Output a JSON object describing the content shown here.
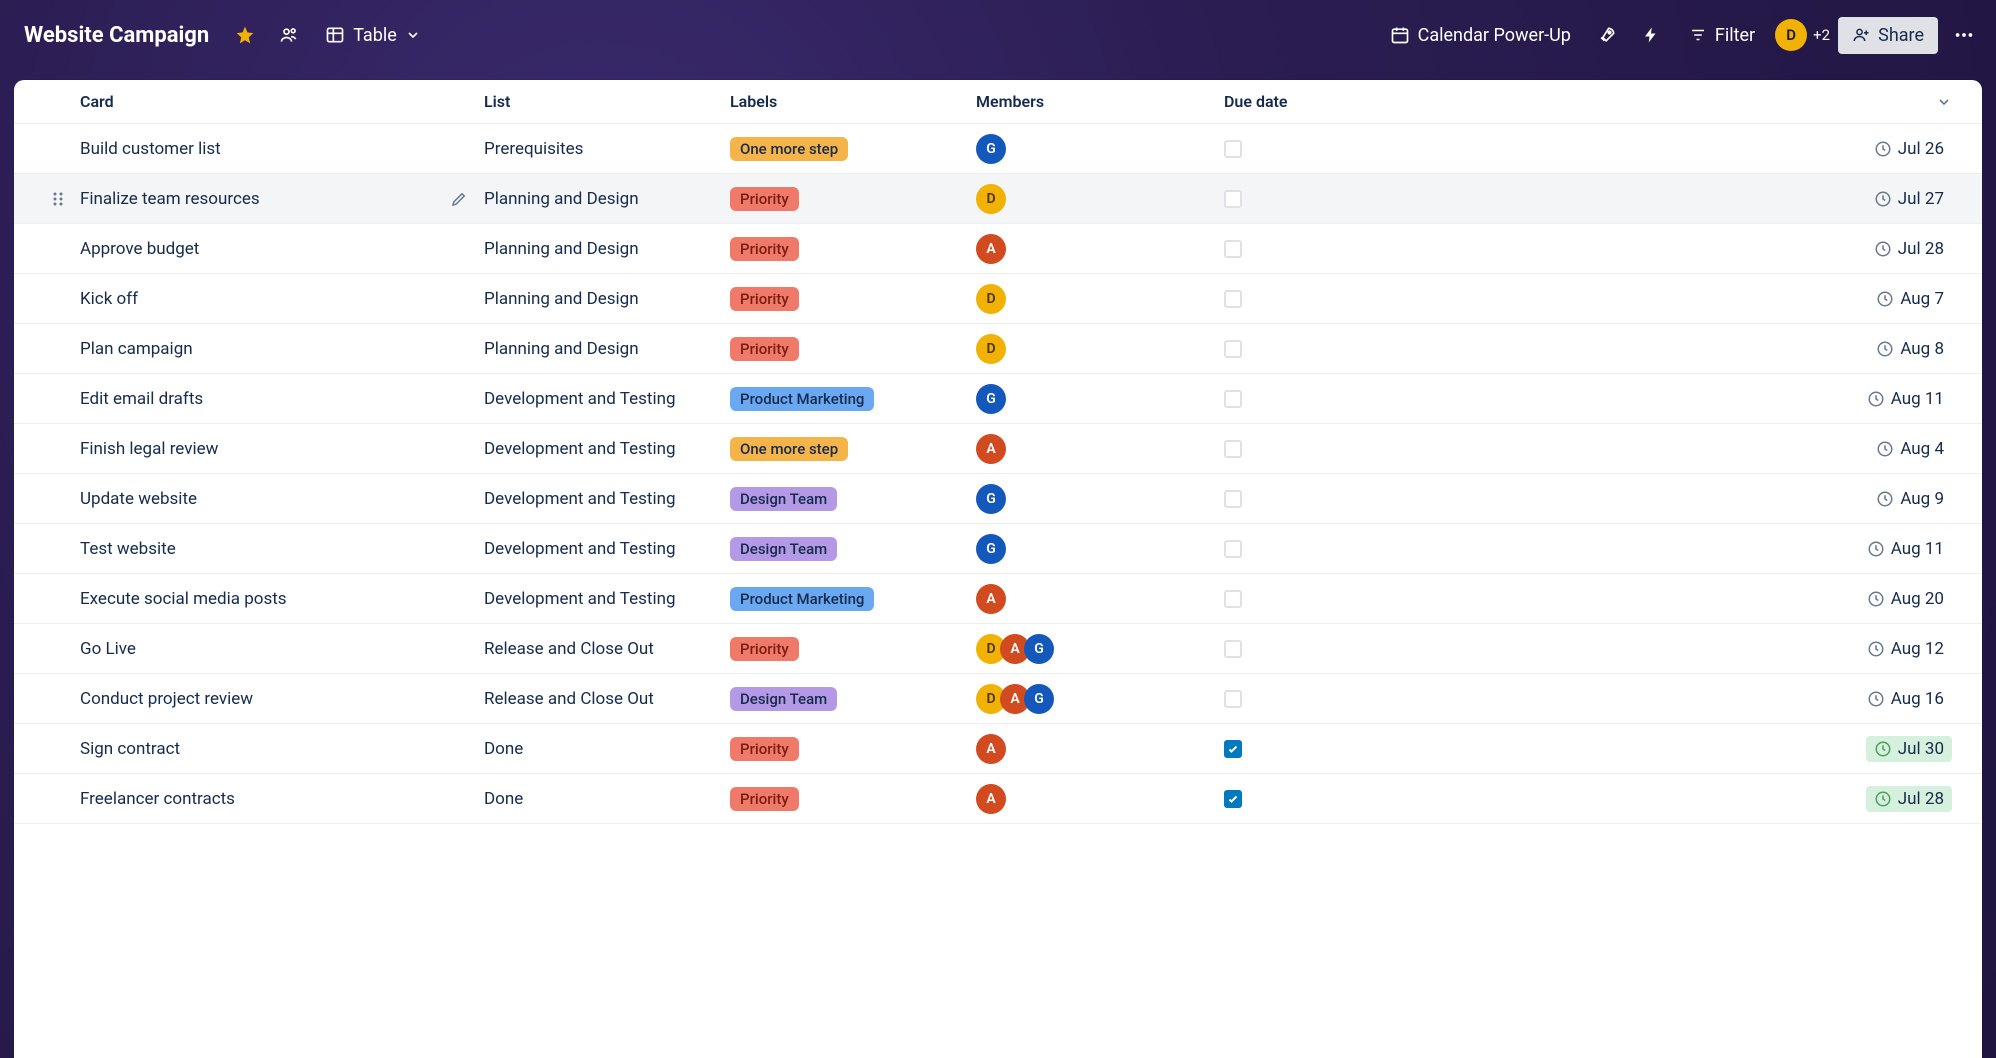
{
  "header": {
    "title": "Website Campaign",
    "view_label": "Table",
    "powerup_label": "Calendar Power-Up",
    "filter_label": "Filter",
    "share_label": "Share",
    "extra_members": "+2",
    "avatar_letter": "D"
  },
  "columns": {
    "card": "Card",
    "list": "List",
    "labels": "Labels",
    "members": "Members",
    "due": "Due date"
  },
  "label_styles": {
    "One more step": {
      "bg": "#f5b44a",
      "fg": "#172b4d"
    },
    "Priority": {
      "bg": "#f07a6a",
      "fg": "#7a1e12"
    },
    "Product Marketing": {
      "bg": "#6aa8f2",
      "fg": "#172b4d"
    },
    "Design Team": {
      "bg": "#b49ae6",
      "fg": "#172b4d"
    }
  },
  "avatar_styles": {
    "G": {
      "bg": "#1558bc",
      "fg": "#ffffff"
    },
    "D": {
      "bg": "#f2b203",
      "fg": "#4d3400"
    },
    "A": {
      "bg": "#d24a20",
      "fg": "#ffffff"
    }
  },
  "rows": [
    {
      "card": "Build customer list",
      "list": "Prerequisites",
      "label": "One more step",
      "members": [
        "G"
      ],
      "due": "Jul 26",
      "done": false
    },
    {
      "card": "Finalize team resources",
      "list": "Planning and Design",
      "label": "Priority",
      "members": [
        "D"
      ],
      "due": "Jul 27",
      "done": false,
      "hover": true
    },
    {
      "card": "Approve budget",
      "list": "Planning and Design",
      "label": "Priority",
      "members": [
        "A"
      ],
      "due": "Jul 28",
      "done": false
    },
    {
      "card": "Kick off",
      "list": "Planning and Design",
      "label": "Priority",
      "members": [
        "D"
      ],
      "due": "Aug 7",
      "done": false
    },
    {
      "card": "Plan campaign",
      "list": "Planning and Design",
      "label": "Priority",
      "members": [
        "D"
      ],
      "due": "Aug 8",
      "done": false
    },
    {
      "card": "Edit email drafts",
      "list": "Development and Testing",
      "label": "Product Marketing",
      "members": [
        "G"
      ],
      "due": "Aug 11",
      "done": false
    },
    {
      "card": "Finish legal review",
      "list": "Development and Testing",
      "label": "One more step",
      "members": [
        "A"
      ],
      "due": "Aug 4",
      "done": false
    },
    {
      "card": "Update website",
      "list": "Development and Testing",
      "label": "Design Team",
      "members": [
        "G"
      ],
      "due": "Aug 9",
      "done": false
    },
    {
      "card": "Test website",
      "list": "Development and Testing",
      "label": "Design Team",
      "members": [
        "G"
      ],
      "due": "Aug 11",
      "done": false
    },
    {
      "card": "Execute social media posts",
      "list": "Development and Testing",
      "label": "Product Marketing",
      "members": [
        "A"
      ],
      "due": "Aug 20",
      "done": false
    },
    {
      "card": "Go Live",
      "list": "Release and Close Out",
      "label": "Priority",
      "members": [
        "D",
        "A",
        "G"
      ],
      "due": "Aug 12",
      "done": false
    },
    {
      "card": "Conduct project review",
      "list": "Release and Close Out",
      "label": "Design Team",
      "members": [
        "D",
        "A",
        "G"
      ],
      "due": "Aug 16",
      "done": false
    },
    {
      "card": "Sign contract",
      "list": "Done",
      "label": "Priority",
      "members": [
        "A"
      ],
      "due": "Jul 30",
      "done": true
    },
    {
      "card": "Freelancer contracts",
      "list": "Done",
      "label": "Priority",
      "members": [
        "A"
      ],
      "due": "Jul 28",
      "done": true
    }
  ]
}
